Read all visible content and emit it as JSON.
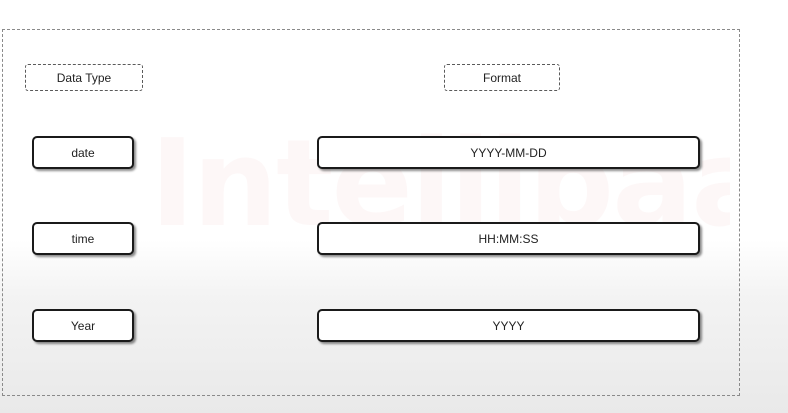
{
  "headers": {
    "data_type": "Data Type",
    "format": "Format"
  },
  "rows": [
    {
      "type": "date",
      "format": "YYYY-MM-DD"
    },
    {
      "type": "time",
      "format": "HH:MM:SS"
    },
    {
      "type": "Year",
      "format": "YYYY"
    }
  ],
  "watermark": "Intellipaat"
}
